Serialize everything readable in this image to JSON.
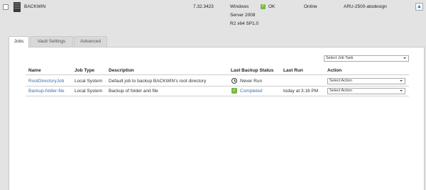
{
  "machine": {
    "name": "BACKWIN",
    "version": "7.32.3423",
    "os_line1": "Windows",
    "os_line2": "Server 2008",
    "os_line3": "R2 x64 SP1.0",
    "status": "OK",
    "connection": "Online",
    "host": "ARU-2500-atodesign",
    "collapse_glyph": "▲"
  },
  "tabs": [
    {
      "label": "Jobs",
      "active": true
    },
    {
      "label": "Vault Settings",
      "active": false
    },
    {
      "label": "Advanced",
      "active": false
    }
  ],
  "job_task_select": {
    "value": "Select Job Task"
  },
  "table": {
    "headers": {
      "name": "Name",
      "type": "Job Type",
      "description": "Description",
      "status": "Last Backup Status",
      "last_run": "Last Run",
      "action": "Action"
    },
    "rows": [
      {
        "name": "RootDirectoryJob",
        "type": "Local System",
        "description": "Default job to backup BACKWIN's root directory",
        "status": "Never Run",
        "status_icon": "clock-icon",
        "last_run": "",
        "action": "Select Action"
      },
      {
        "name": "Backup-folder-file",
        "type": "Local System",
        "description": "Backup of folder and file",
        "status": "Completed",
        "status_icon": "check-icon",
        "last_run": "today at 3:16 PM",
        "action": "Select Action"
      }
    ]
  },
  "colors": {
    "link": "#3a6fb0",
    "ok_green": "#7bb842",
    "background": "#e3e3e3"
  }
}
